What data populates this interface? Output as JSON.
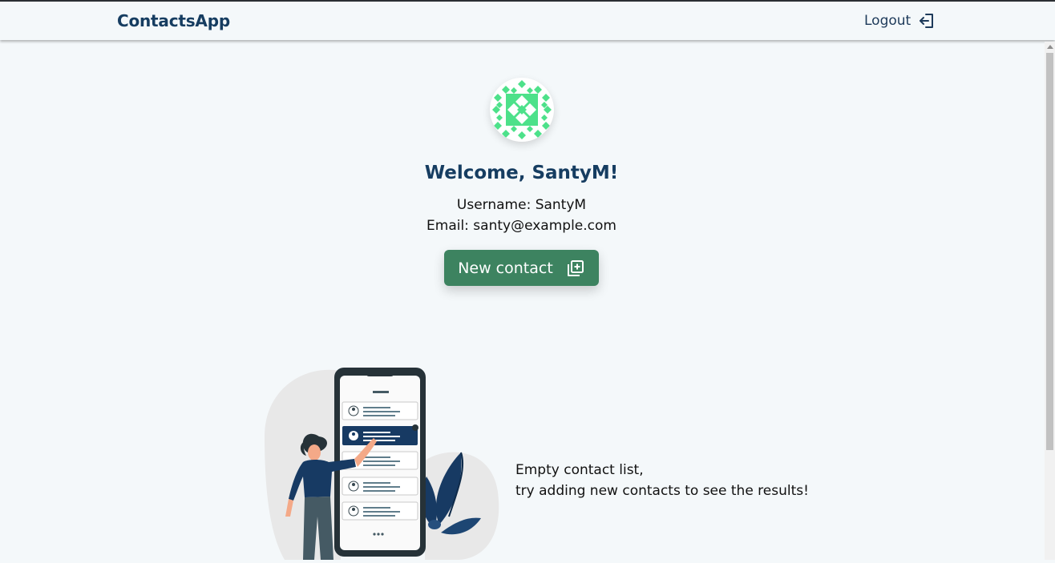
{
  "navbar": {
    "brand": "ContactsApp",
    "logout_label": "Logout"
  },
  "profile": {
    "welcome": "Welcome, SantyM!",
    "username_line": "Username: SantyM",
    "email_line": "Email: santy@example.com"
  },
  "actions": {
    "new_contact_label": "New contact"
  },
  "empty_state": {
    "line1": "Empty contact list,",
    "line2": "try adding new contacts to see the results!"
  },
  "colors": {
    "brand": "#163d61",
    "button": "#3d8360",
    "background": "#f4f8fa",
    "avatar_pattern": "#4de18a"
  },
  "icons": {
    "logout": "logout-icon",
    "new_contact": "add-box-icon"
  }
}
